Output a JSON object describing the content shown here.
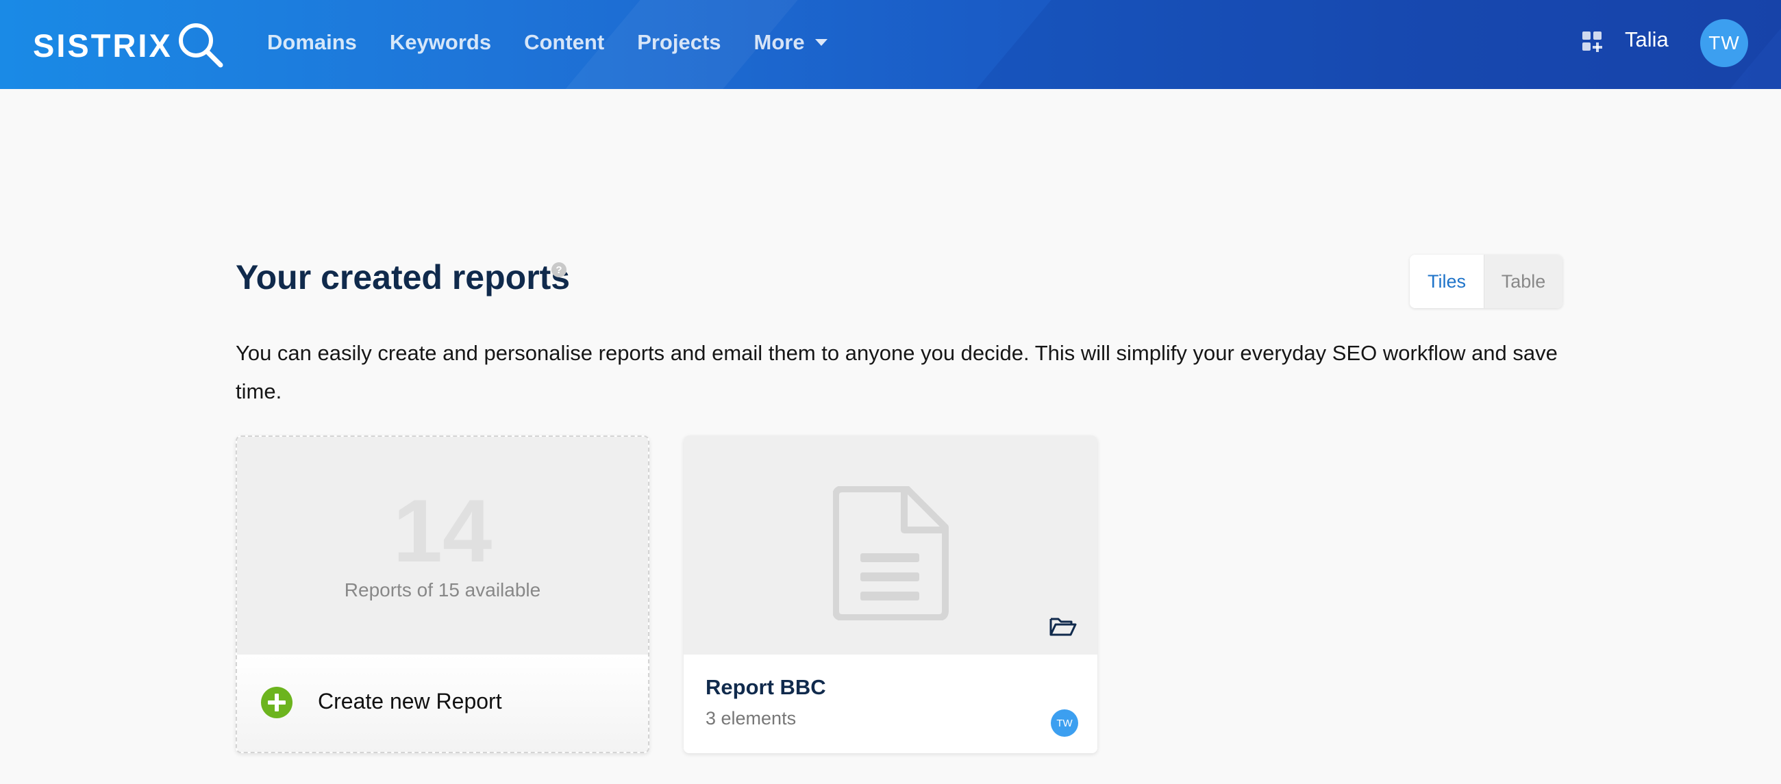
{
  "brand": {
    "logo_text": "SISTRIX",
    "accent": "#1a6fd6"
  },
  "nav": {
    "items": [
      {
        "label": "Domains"
      },
      {
        "label": "Keywords"
      },
      {
        "label": "Content"
      },
      {
        "label": "Projects"
      },
      {
        "label": "More",
        "icon": "caret-down-icon"
      }
    ]
  },
  "user": {
    "name": "Talia",
    "initials": "TW"
  },
  "header_icons": {
    "apps": "apps-grid-icon"
  },
  "main": {
    "title": "Your created reports",
    "help_icon": "question-circle-icon",
    "view_toggle": {
      "tiles": "Tiles",
      "table": "Table",
      "selected": "Tiles"
    },
    "intro": "You can easily create and personalise reports and email them to anyone you decide. This will simplify your everyday SEO workflow and save time."
  },
  "cards": {
    "create": {
      "count": "14",
      "caption": "Reports of 15 available",
      "label": "Create new Report",
      "icon": "plus-circle-icon",
      "icon_color": "#6cb41e"
    },
    "report": {
      "name": "Report BBC",
      "meta": "3 elements",
      "owner_initials": "TW",
      "icon": "document-icon",
      "folder_icon": "folder-open-icon"
    }
  }
}
